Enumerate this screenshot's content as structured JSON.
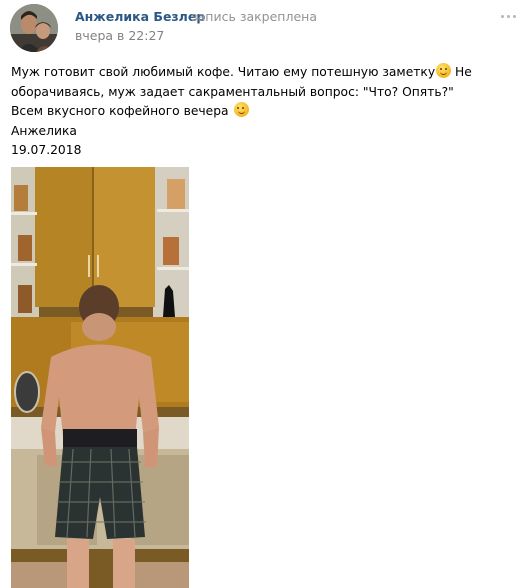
{
  "post": {
    "author": "Анжелика Безлер",
    "pinned_label": "запись закреплена",
    "time": "вчера в 22:27",
    "menu_icon": "more-dots-icon",
    "text_lines": [
      "Муж готовит свой любимый кофе. Читаю ему потешную заметку",
      "оборачиваясь, муж задает сакраментальный вопрос: \"Что? Опять?\"",
      "Всем вкусного кофейного вечера",
      "Анжелика",
      "19.07.2018"
    ],
    "line1_tail": " Не",
    "emoji": "smiling-face-icon"
  },
  "colors": {
    "author": "#2a5885",
    "meta": "#939393",
    "background": "#ffffff"
  }
}
